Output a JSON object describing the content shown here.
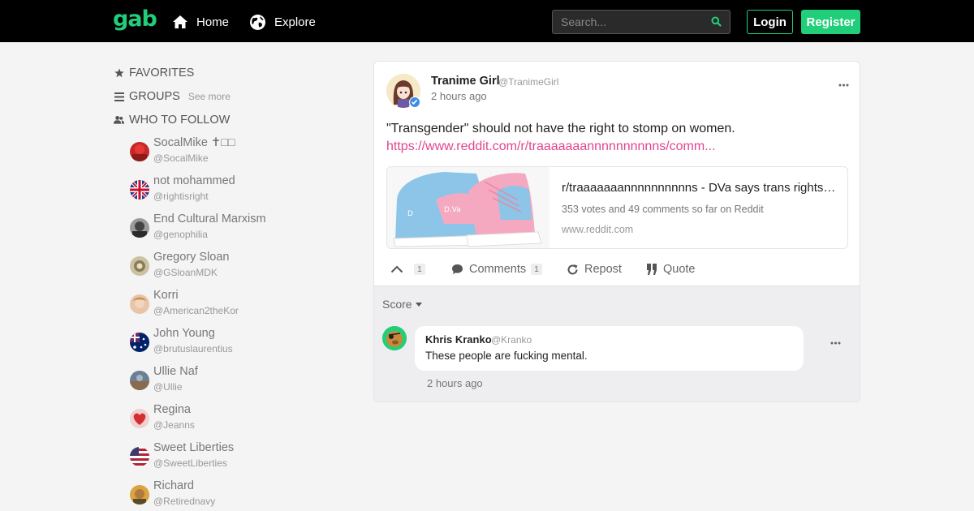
{
  "header": {
    "logo": "gab",
    "nav": [
      {
        "label": "Home",
        "icon": "home-icon"
      },
      {
        "label": "Explore",
        "icon": "globe-icon"
      }
    ],
    "search_placeholder": "Search...",
    "login_label": "Login",
    "register_label": "Register",
    "accent_color": "#21cf7a"
  },
  "sidebar": {
    "favorites_label": "FAVORITES",
    "groups_label": "GROUPS",
    "groups_see_more": "See more",
    "who_to_follow_label": "WHO TO FOLLOW",
    "follow": [
      {
        "name": "SocalMike ✝□□",
        "handle": "@SocalMike"
      },
      {
        "name": "not mohammed",
        "handle": "@rightisright"
      },
      {
        "name": "End Cultural Marxism",
        "handle": "@genophilia"
      },
      {
        "name": "Gregory Sloan",
        "handle": "@GSloanMDK"
      },
      {
        "name": "Korri",
        "handle": "@American2theKor"
      },
      {
        "name": "John Young",
        "handle": "@brutuslaurentius"
      },
      {
        "name": "Ullie Naf",
        "handle": "@Ullie"
      },
      {
        "name": "Regina",
        "handle": "@Jeanns"
      },
      {
        "name": "Sweet Liberties",
        "handle": "@SweetLiberties"
      },
      {
        "name": "Richard",
        "handle": "@Retirednavy"
      }
    ]
  },
  "post": {
    "author_name": "Tranime Girl",
    "author_handle": "@TranimeGirl",
    "time": "2 hours ago",
    "text": "\"Transgender\" should not have the right to stomp on women.",
    "link": "https://www.reddit.com/r/traaaaaaannnnnnnnnns/comm...",
    "preview": {
      "title": "r/traaaaaaannnnnnnnnns - DVa says trans rights…",
      "description": "353 votes and 49 comments so far on Reddit",
      "domain": "www.reddit.com"
    },
    "actions": {
      "upvote_count": "1",
      "comments_label": "Comments",
      "comments_count": "1",
      "repost_label": "Repost",
      "quote_label": "Quote"
    }
  },
  "comments_section": {
    "sort_label": "Score",
    "comments": [
      {
        "author_name": "Khris Kranko",
        "author_handle": "@Kranko",
        "text": "These people are fucking mental.",
        "time": "2 hours ago"
      }
    ]
  }
}
